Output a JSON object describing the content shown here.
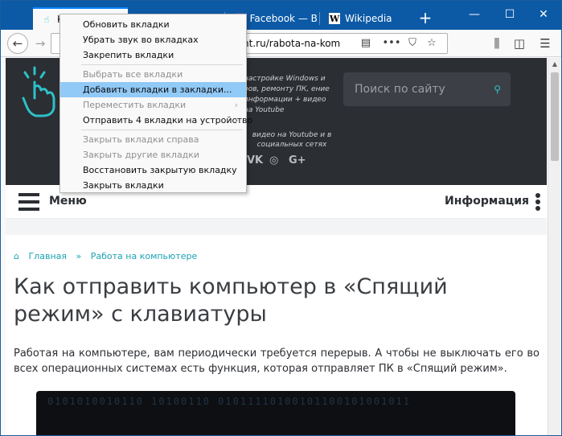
{
  "tabs": [
    {
      "label": "К",
      "icon": "pointer-hand-icon",
      "active": true
    },
    {
      "label": "Facebook — Вып",
      "icon": "facebook-icon",
      "active": false
    },
    {
      "label": "Wikipedia",
      "icon": "wikipedia-icon",
      "active": false
    }
  ],
  "window_controls": {
    "new_tab": "+",
    "minimize": "—",
    "maximize": "☐",
    "close": "✕"
  },
  "urlbar": {
    "url_visible": "tant.ru/rabota-na-kom"
  },
  "context_menu": {
    "items": [
      {
        "label": "Обновить вкладки",
        "disabled": false,
        "highlighted": false,
        "submenu": false
      },
      {
        "label": "Убрать звук во вкладках",
        "disabled": false,
        "highlighted": false,
        "submenu": false
      },
      {
        "label": "Закрепить вкладки",
        "disabled": false,
        "highlighted": false,
        "submenu": false
      },
      {
        "separator": true
      },
      {
        "label": "Выбрать все вкладки",
        "disabled": true,
        "highlighted": false,
        "submenu": false
      },
      {
        "label": "Добавить вкладки в закладки...",
        "disabled": false,
        "highlighted": true,
        "submenu": false
      },
      {
        "label": "Переместить вкладки",
        "disabled": true,
        "highlighted": false,
        "submenu": true
      },
      {
        "label": "Отправить 4 вкладки на устройство",
        "disabled": false,
        "highlighted": false,
        "submenu": true
      },
      {
        "separator": true
      },
      {
        "label": "Закрыть вкладки справа",
        "disabled": true,
        "highlighted": false,
        "submenu": false
      },
      {
        "label": "Закрыть другие вкладки",
        "disabled": true,
        "highlighted": false,
        "submenu": false
      },
      {
        "label": "Восстановить закрытую вкладку",
        "disabled": false,
        "highlighted": false,
        "submenu": false
      },
      {
        "label": "Закрыть вкладки",
        "disabled": false,
        "highlighted": false,
        "submenu": false
      }
    ]
  },
  "site": {
    "description": "настройке Windows и ров, ремонту ПК, ение информации + видео на Youtube",
    "description2": "видео на Youtube и в социальных сетях",
    "search_placeholder": "Поиск по сайту",
    "social": {
      "vk": "VK",
      "instagram": "◎",
      "gplus": "G+"
    },
    "menu_label": "Меню",
    "info_label": "Информация",
    "breadcrumb": {
      "home": "Главная",
      "sep": "»",
      "section": "Работа на компьютере"
    },
    "title": "Как отправить компьютер в «Спящий режим» с клавиатуры",
    "intro": "Работая на компьютере, вам периодически требуется перерыв. А чтобы не выключать его во всех операционных системах есть функция, которая отправляет ПК в «Спящий режим».",
    "binary_text": "0101010010110 10100110 01011110100101100101001011"
  },
  "colors": {
    "tabstrip": "#0c5aa6",
    "accent": "#1aa3b3",
    "header_bg": "#2b2e33",
    "menu_highlight": "#91c9f7"
  }
}
